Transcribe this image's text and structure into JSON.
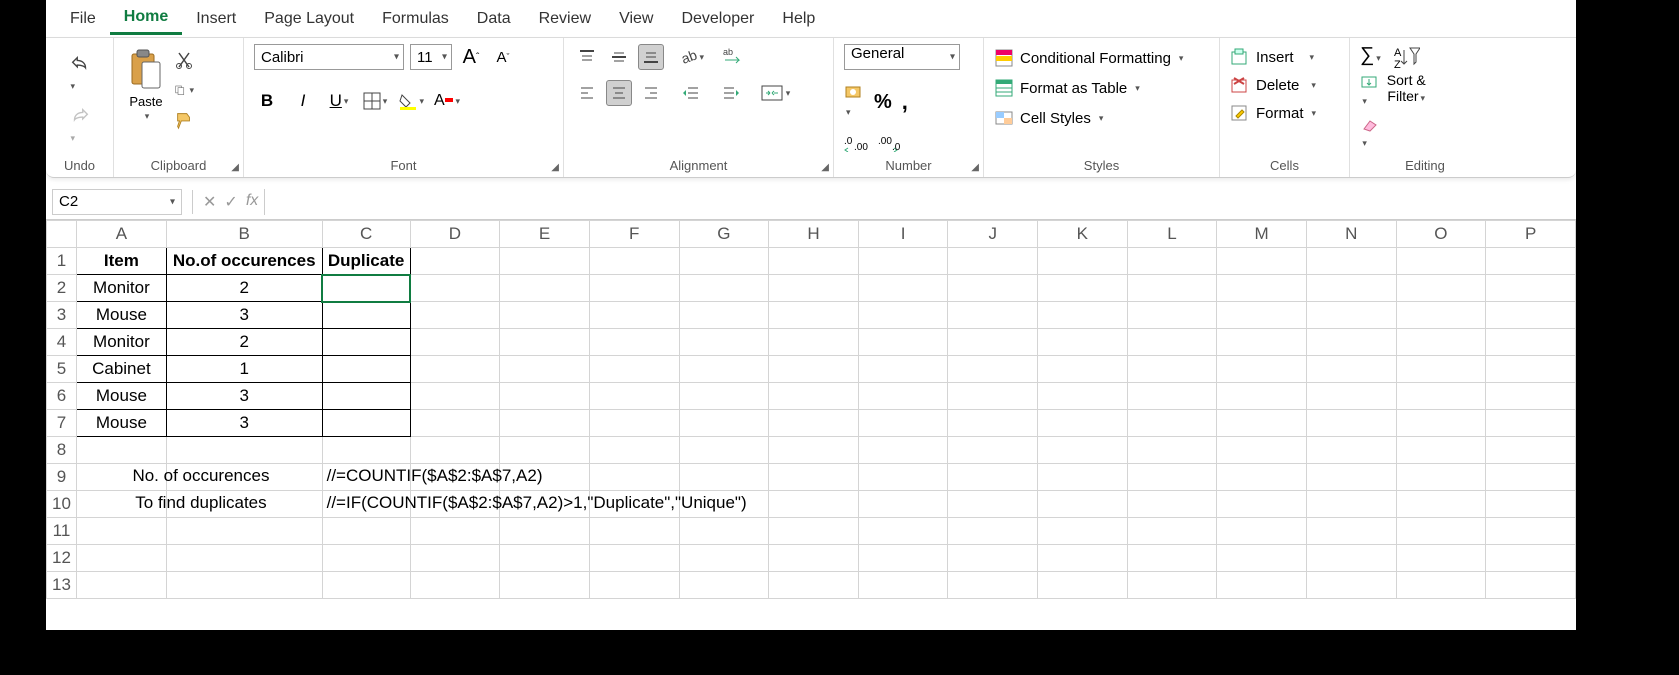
{
  "menu": {
    "items": [
      "File",
      "Home",
      "Insert",
      "Page Layout",
      "Formulas",
      "Data",
      "Review",
      "View",
      "Developer",
      "Help"
    ],
    "active": 1
  },
  "ribbon": {
    "undo_group": "Undo",
    "clipboard": {
      "paste": "Paste",
      "label": "Clipboard"
    },
    "font": {
      "name": "Calibri",
      "size": "11",
      "label": "Font"
    },
    "alignment": {
      "label": "Alignment"
    },
    "number": {
      "format": "General",
      "label": "Number"
    },
    "styles": {
      "conditional": "Conditional Formatting",
      "table": "Format as Table",
      "cell": "Cell Styles",
      "label": "Styles"
    },
    "cells": {
      "insert": "Insert",
      "delete": "Delete",
      "format": "Format",
      "label": "Cells"
    },
    "editing": {
      "sort": "Sort &",
      "filter": "Filter",
      "label": "Editing"
    }
  },
  "namebox": "C2",
  "formula": "",
  "columns": [
    "A",
    "B",
    "C",
    "D",
    "E",
    "F",
    "G",
    "H",
    "I",
    "J",
    "K",
    "L",
    "M",
    "N",
    "O",
    "P"
  ],
  "rows": [
    "1",
    "2",
    "3",
    "4",
    "5",
    "6",
    "7",
    "8",
    "9",
    "10",
    "11",
    "12",
    "13"
  ],
  "headers": {
    "A1": "Item",
    "B1": "No.of occurences",
    "C1": "Duplicate"
  },
  "data": [
    {
      "item": "Monitor",
      "occ": "2"
    },
    {
      "item": "Mouse",
      "occ": "3"
    },
    {
      "item": "Monitor",
      "occ": "2"
    },
    {
      "item": "Cabinet",
      "occ": "1"
    },
    {
      "item": "Mouse",
      "occ": "3"
    },
    {
      "item": "Mouse",
      "occ": "3"
    }
  ],
  "notes": {
    "r9_label": "No. of occurences",
    "r9_formula": "//=COUNTIF($A$2:$A$7,A2)",
    "r10_label": "To find duplicates",
    "r10_formula": "//=IF(COUNTIF($A$2:$A$7,A2)>1,\"Duplicate\",\"Unique\")"
  }
}
